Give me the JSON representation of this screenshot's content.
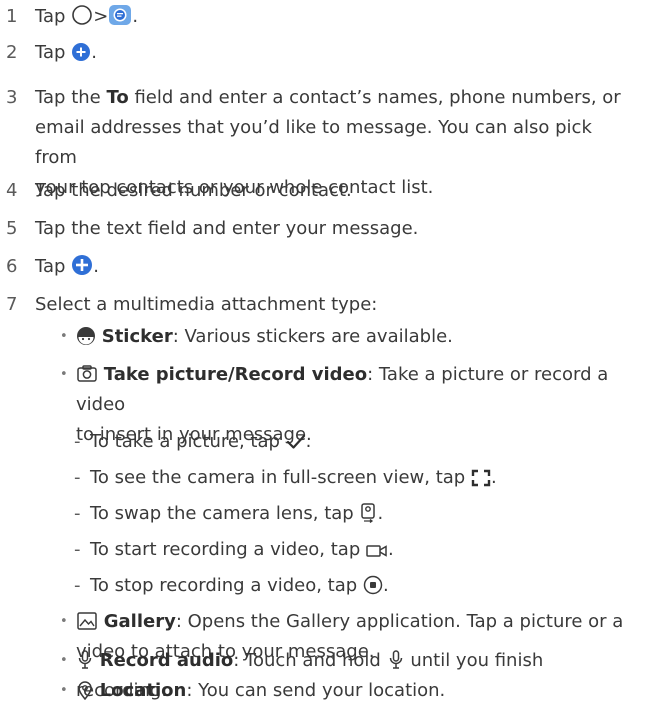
{
  "steps": [
    {
      "num": "1",
      "tap": "Tap",
      "gt": ">",
      "end": "."
    },
    {
      "num": "2",
      "tap": "Tap",
      "end": "."
    },
    {
      "num": "3",
      "pre": "Tap the",
      "bold": "To",
      "rest": "field and enter a contact’s names, phone numbers, or",
      "line2": "email addresses that you’d like to message. You can also pick from",
      "line3": "your top contacts or your whole contact list."
    },
    {
      "num": "4",
      "text": "Tap the desired number or contact."
    },
    {
      "num": "5",
      "text": "Tap the text field and enter your message."
    },
    {
      "num": "6",
      "tap": "Tap",
      "end": "."
    },
    {
      "num": "7",
      "text": "Select a multimedia attachment type:"
    }
  ],
  "bullets": {
    "sticker": {
      "label": "Sticker",
      "desc": ": Various stickers are available."
    },
    "take_picture": {
      "label": "Take picture/Record video",
      "desc": ": Take a picture or record a video",
      "line2": "to insert in your message."
    },
    "gallery": {
      "label": "Gallery",
      "desc": ": Opens the Gallery application. Tap a picture or a",
      "line2": "video to attach to your message."
    },
    "record_audio": {
      "label": "Record audio",
      "desc": ": Touch and hold",
      "desc2": "until you finish recording."
    },
    "location": {
      "label": "Location",
      "desc": ": You can send your location."
    }
  },
  "camera_subs": [
    {
      "text": "To take a picture, tap",
      "icon": "checkmark-icon"
    },
    {
      "text": "To see the camera in full-screen view, tap",
      "icon": "fullscreen-corners-icon"
    },
    {
      "text": "To swap the camera lens, tap",
      "icon": "swap-camera-icon"
    },
    {
      "text": "To start recording a video, tap",
      "icon": "video-camera-icon"
    },
    {
      "text": "To stop recording a video, tap",
      "icon": "stop-record-icon"
    }
  ],
  "dash": "-",
  "bullet_char": "•",
  "colors": {
    "accent_blue": "#2f6fd6",
    "text": "#3a3a3a"
  }
}
